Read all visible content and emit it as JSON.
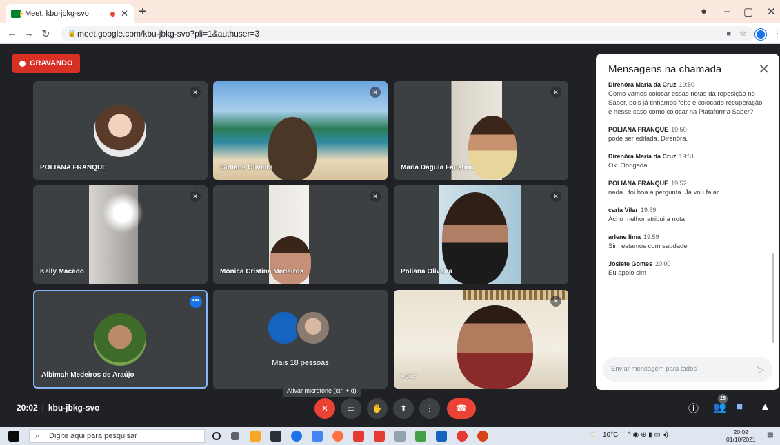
{
  "browser": {
    "tab_title": "Meet: kbu-jbkg-svo",
    "url": "meet.google.com/kbu-jbkg-svo?pli=1&authuser=3"
  },
  "meet": {
    "recording_label": "GRAVANDO",
    "time": "20:02",
    "meeting_code": "kbu-jbkg-svo",
    "mic_tooltip": "Ativar microfone (ctrl + d)",
    "people_count": "26",
    "accent": "#1a73e8",
    "end_call_color": "#ea4335"
  },
  "tiles": [
    {
      "name": "POLIANA FRANQUE"
    },
    {
      "name": "Girliane Oliveira"
    },
    {
      "name": "Maria Daguia Faustino"
    },
    {
      "name": "Kelly Macêdo"
    },
    {
      "name": "Mônica Cristina Medeiros"
    },
    {
      "name": "Poliana Oliveira"
    },
    {
      "name": "Albimah Medeiros de Araújo"
    },
    {
      "name": "Mais 18 pessoas"
    },
    {
      "name": "Você"
    }
  ],
  "chat": {
    "title": "Mensagens na chamada",
    "input_placeholder": "Enviar mensagem para todos",
    "messages": [
      {
        "author": "Direnôra Maria da Cruz",
        "time": "19:50",
        "text": "Como vamos colocar essas notas da reposição no Saber, pois já tinhamos feito e colocado recuperação e nesse caso como colocar na Plataforma Saber?"
      },
      {
        "author": "POLIANA FRANQUE",
        "time": "19:50",
        "text": "pode ser editada, Direnôra."
      },
      {
        "author": "Direnôra Maria da Cruz",
        "time": "19:51",
        "text": "Ok. Obrigada"
      },
      {
        "author": "POLIANA FRANQUE",
        "time": "19:52",
        "text": "nada.. foi boa a pergunta. Já vou falar."
      },
      {
        "author": "carla Vilar",
        "time": "19:59",
        "text": "Acho melhor atribui a nota"
      },
      {
        "author": "arlene lima",
        "time": "19:59",
        "text": "Sim estamos com saudade"
      },
      {
        "author": "Josiete Gomes",
        "time": "20:00",
        "text": "Eu apoio sim"
      }
    ]
  },
  "taskbar": {
    "search_placeholder": "Digite aqui para pesquisar",
    "temperature": "10°C",
    "clock_time": "20:02",
    "clock_date": "01/10/2021"
  }
}
